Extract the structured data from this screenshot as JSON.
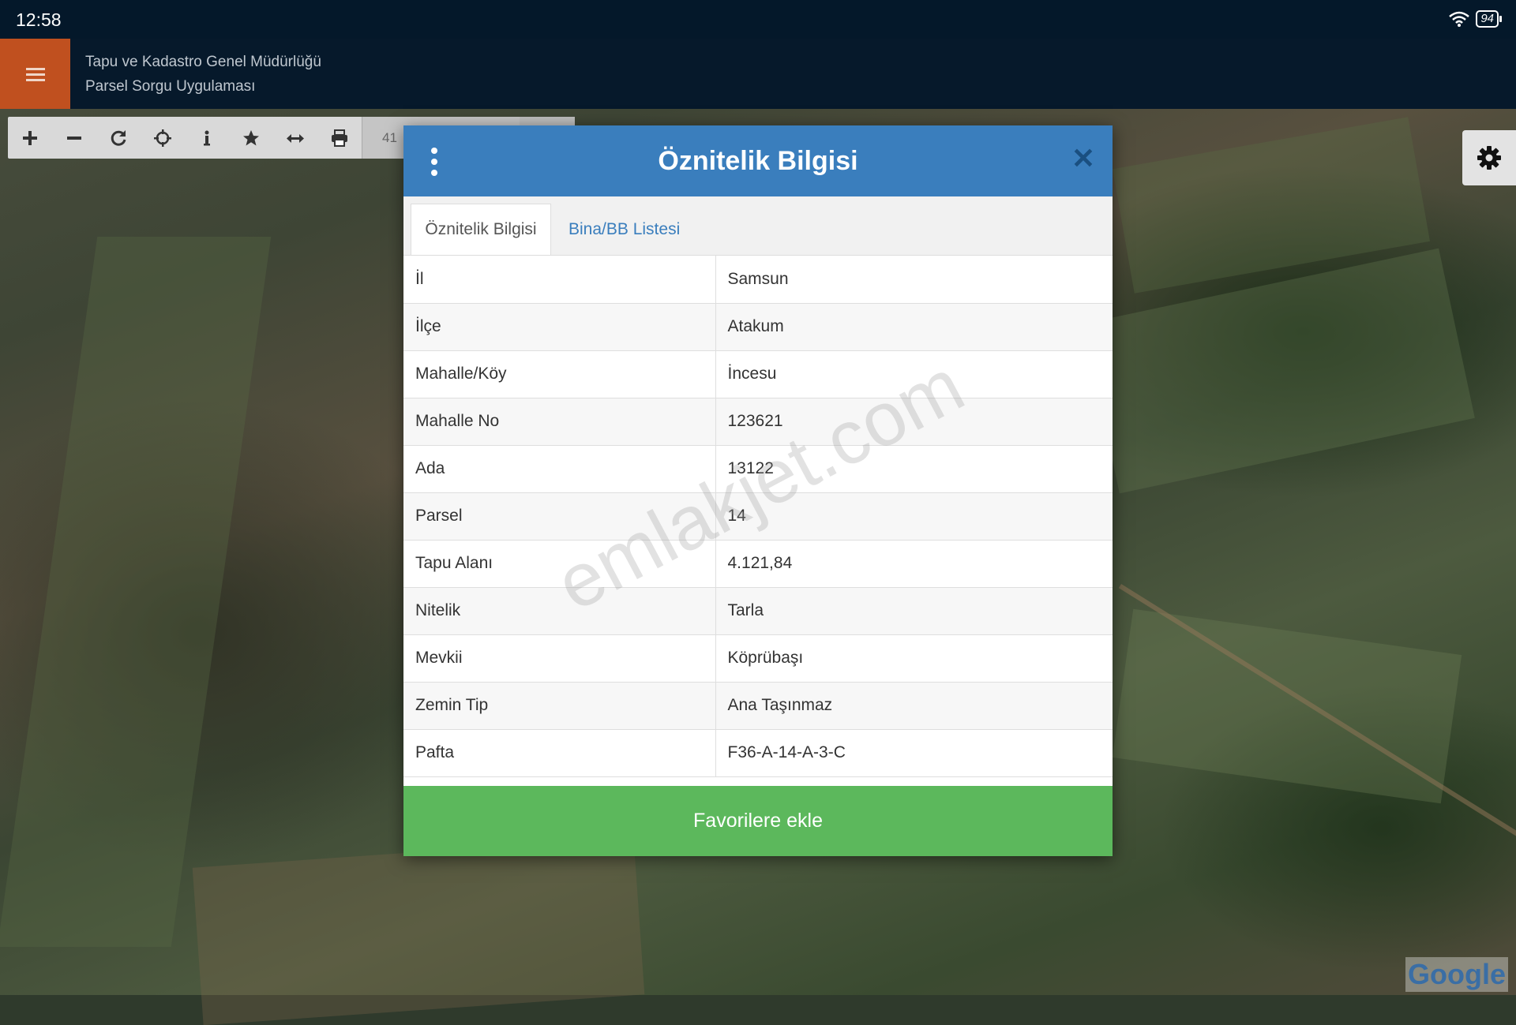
{
  "status_bar": {
    "time": "12:58",
    "battery": "94"
  },
  "app": {
    "title_line1": "Tapu ve Kadastro Genel Müdürlüğü",
    "title_line2": "Parsel Sorgu Uygulaması"
  },
  "toolbar": {
    "tools": [
      "zoom-in-icon",
      "zoom-out-icon",
      "refresh-icon",
      "locate-icon",
      "info-icon",
      "star-icon",
      "measure-icon",
      "print-icon"
    ],
    "scale_value": "41"
  },
  "modal": {
    "title": "Öznitelik Bilgisi",
    "tabs": [
      {
        "label": "Öznitelik Bilgisi",
        "active": true
      },
      {
        "label": "Bina/BB Listesi",
        "active": false
      }
    ],
    "rows": [
      {
        "key": "İl",
        "value": "Samsun"
      },
      {
        "key": "İlçe",
        "value": "Atakum"
      },
      {
        "key": "Mahalle/Köy",
        "value": "İncesu"
      },
      {
        "key": "Mahalle No",
        "value": "123621"
      },
      {
        "key": "Ada",
        "value": "13122"
      },
      {
        "key": "Parsel",
        "value": "14"
      },
      {
        "key": "Tapu Alanı",
        "value": "4.121,84"
      },
      {
        "key": "Nitelik",
        "value": "Tarla"
      },
      {
        "key": "Mevkii",
        "value": "Köprübaşı"
      },
      {
        "key": "Zemin Tip",
        "value": "Ana Taşınmaz"
      },
      {
        "key": "Pafta",
        "value": "F36-A-14-A-3-C"
      }
    ],
    "favorite_button": "Favorilere ekle"
  },
  "watermark": "emlakjet.com",
  "map": {
    "attribution": "Google"
  },
  "colors": {
    "header_blue": "#3a7ebd",
    "menu_orange": "#c0501f",
    "favorite_green": "#5cb85c"
  }
}
